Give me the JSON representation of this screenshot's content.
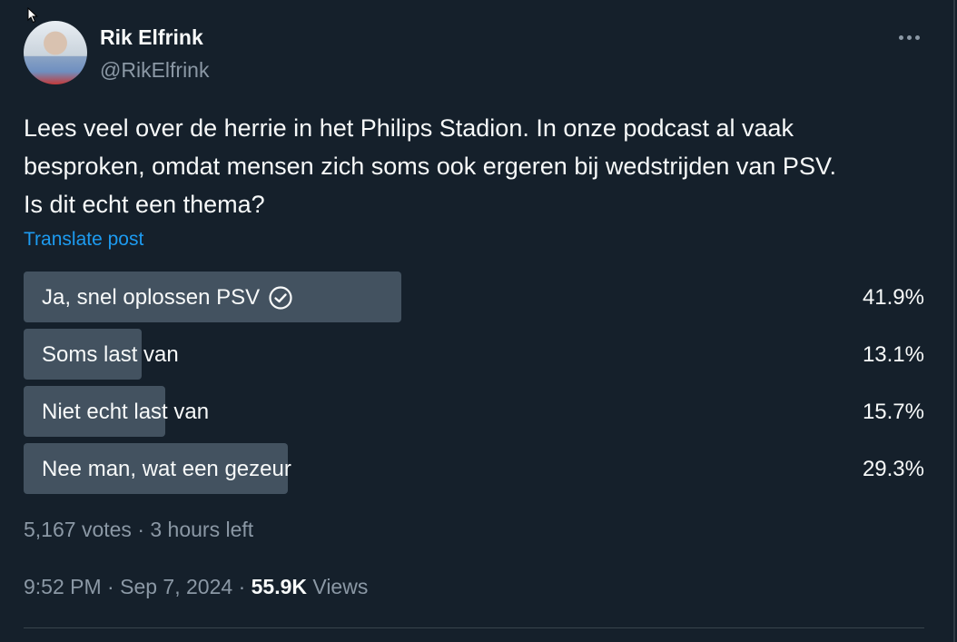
{
  "author": {
    "name": "Rik Elfrink",
    "handle": "@RikElfrink"
  },
  "post": {
    "lines": [
      "Lees veel over de herrie in het Philips Stadion. In onze podcast al vaak",
      "besproken, omdat mensen zich soms ook ergeren bij wedstrijden van PSV.",
      "Is dit echt een thema?"
    ],
    "translate_label": "Translate post"
  },
  "poll": {
    "options": [
      {
        "label": "Ja, snel oplossen PSV",
        "percent_label": "41.9%",
        "percent": 41.9,
        "selected": true
      },
      {
        "label": "Soms last van",
        "percent_label": "13.1%",
        "percent": 13.1,
        "selected": false
      },
      {
        "label": "Niet echt last van",
        "percent_label": "15.7%",
        "percent": 15.7,
        "selected": false
      },
      {
        "label": "Nee man, wat een gezeur",
        "percent_label": "29.3%",
        "percent": 29.3,
        "selected": false
      }
    ],
    "votes": "5,167 votes",
    "separator": "·",
    "time_left": "3 hours left"
  },
  "meta": {
    "time": "9:52 PM",
    "date": "Sep 7, 2024",
    "separator": "·",
    "views_count": "55.9K",
    "views_label": "Views"
  },
  "colors": {
    "background": "#15202b",
    "poll_bar": "#435260",
    "link": "#1d9bf0",
    "muted": "#8b98a5"
  },
  "icons": [
    "more-horizontal-icon",
    "check-circle-icon",
    "mouse-cursor-icon"
  ]
}
